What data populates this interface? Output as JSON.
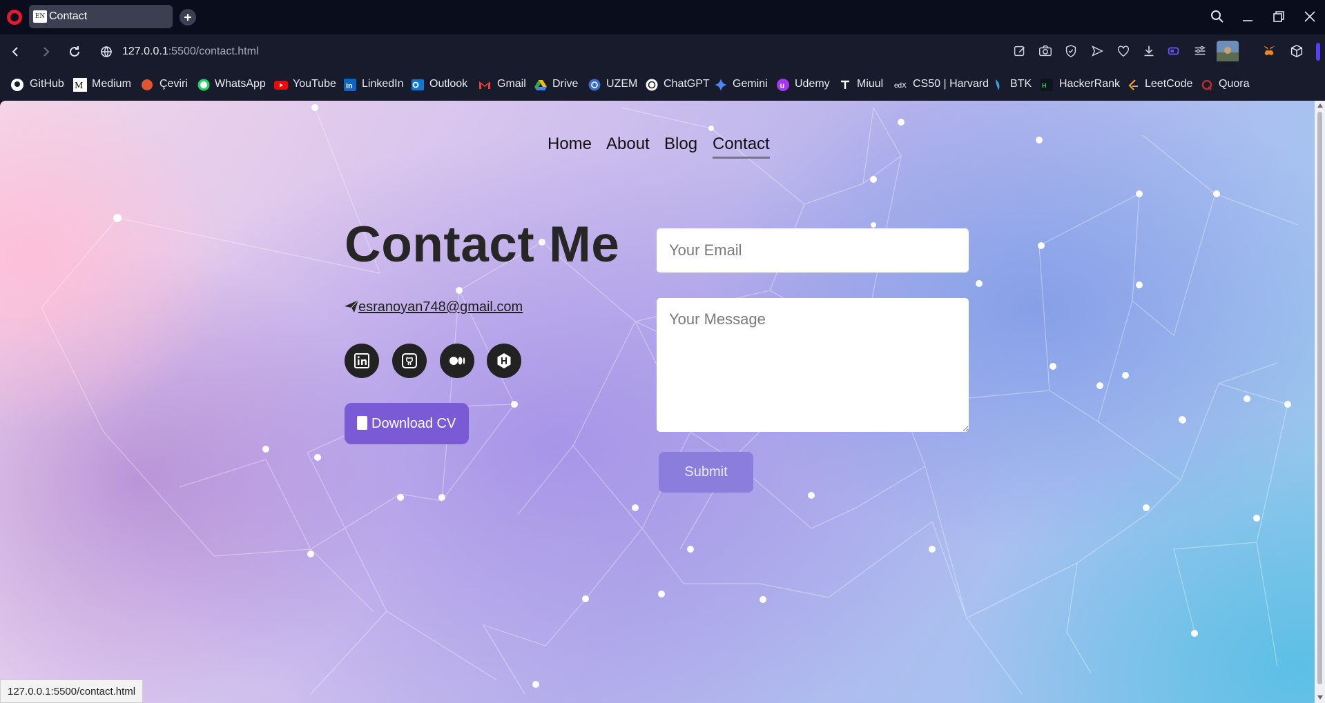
{
  "browser": {
    "tab_title": "Contact",
    "tab_favicon_text": "EN",
    "url_host": "127.0.0.1",
    "url_path": ":5500/contact.html",
    "status_bar_url": "127.0.0.1:5500/contact.html"
  },
  "bookmarks": [
    {
      "label": "GitHub",
      "icon": "github-icon",
      "color": "#ffffff"
    },
    {
      "label": "Medium",
      "icon": "medium-icon",
      "color": "#ffffff"
    },
    {
      "label": "Çeviri",
      "icon": "translate-icon",
      "color": "#e0542e"
    },
    {
      "label": "WhatsApp",
      "icon": "whatsapp-icon",
      "color": "#25d366"
    },
    {
      "label": "YouTube",
      "icon": "youtube-icon",
      "color": "#ff0000"
    },
    {
      "label": "LinkedIn",
      "icon": "linkedin-icon",
      "color": "#0a66c2"
    },
    {
      "label": "Outlook",
      "icon": "outlook-icon",
      "color": "#0f78d4"
    },
    {
      "label": "Gmail",
      "icon": "gmail-icon",
      "color": "#ea4335"
    },
    {
      "label": "Drive",
      "icon": "drive-icon",
      "color": "#fbbc04"
    },
    {
      "label": "UZEM",
      "icon": "uzem-icon",
      "color": "#3a6fc4"
    },
    {
      "label": "ChatGPT",
      "icon": "chatgpt-icon",
      "color": "#ffffff"
    },
    {
      "label": "Gemini",
      "icon": "gemini-icon",
      "color": "#4f86f7"
    },
    {
      "label": "Udemy",
      "icon": "udemy-icon",
      "color": "#a435f0"
    },
    {
      "label": "Miuul",
      "icon": "miuul-icon",
      "color": "#ffffff"
    },
    {
      "label": "CS50 | Harvard",
      "icon": "edx-icon",
      "color": "#ffffff"
    },
    {
      "label": "BTK",
      "icon": "btk-icon",
      "color": "#3aa0e8"
    },
    {
      "label": "HackerRank",
      "icon": "hackerrank-icon",
      "color": "#2ec866"
    },
    {
      "label": "LeetCode",
      "icon": "leetcode-icon",
      "color": "#f89f1b"
    },
    {
      "label": "Quora",
      "icon": "quora-icon",
      "color": "#b92b27"
    }
  ],
  "site": {
    "nav": {
      "home": "Home",
      "about": "About",
      "blog": "Blog",
      "contact": "Contact",
      "active": "Contact"
    },
    "heading": "Contact Me",
    "email": "esranoyan748@gmail.com",
    "social_icons": [
      "linkedin-icon",
      "github-icon",
      "medium-icon",
      "hashnode-icon"
    ],
    "download_cv": "Download CV",
    "form": {
      "email_placeholder": "Your Email",
      "message_placeholder": "Your Message",
      "submit": "Submit"
    }
  },
  "colors": {
    "accent": "#7b5ad6",
    "submit": "#8a7ddb",
    "browser_bg": "#0a0d1c",
    "toolbar_bg": "#171b2c",
    "opera_red": "#e6192e"
  }
}
